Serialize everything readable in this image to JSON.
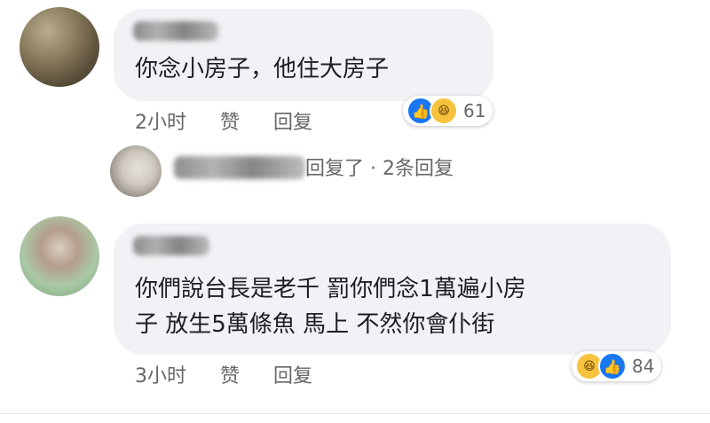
{
  "comments": [
    {
      "text": "你念小房子，他住大房子",
      "time": "2小时",
      "like_label": "赞",
      "reply_label": "回复",
      "reaction_count": "61",
      "replies_summary": {
        "suffix": "回复了 · 2条回复"
      }
    },
    {
      "text_line1": "你們說台長是老千 罰你們念1萬遍小房",
      "text_line2": "子 放生5萬條魚 馬上 不然你會仆街",
      "time": "3小时",
      "like_label": "赞",
      "reply_label": "回复",
      "reaction_count": "84"
    }
  ],
  "colors": {
    "bubble": "#f0f2f5",
    "meta_text": "#65676b",
    "like_blue": "#1877f2",
    "haha_yellow": "#f7c33e"
  },
  "icons": [
    "like-icon",
    "haha-icon"
  ]
}
